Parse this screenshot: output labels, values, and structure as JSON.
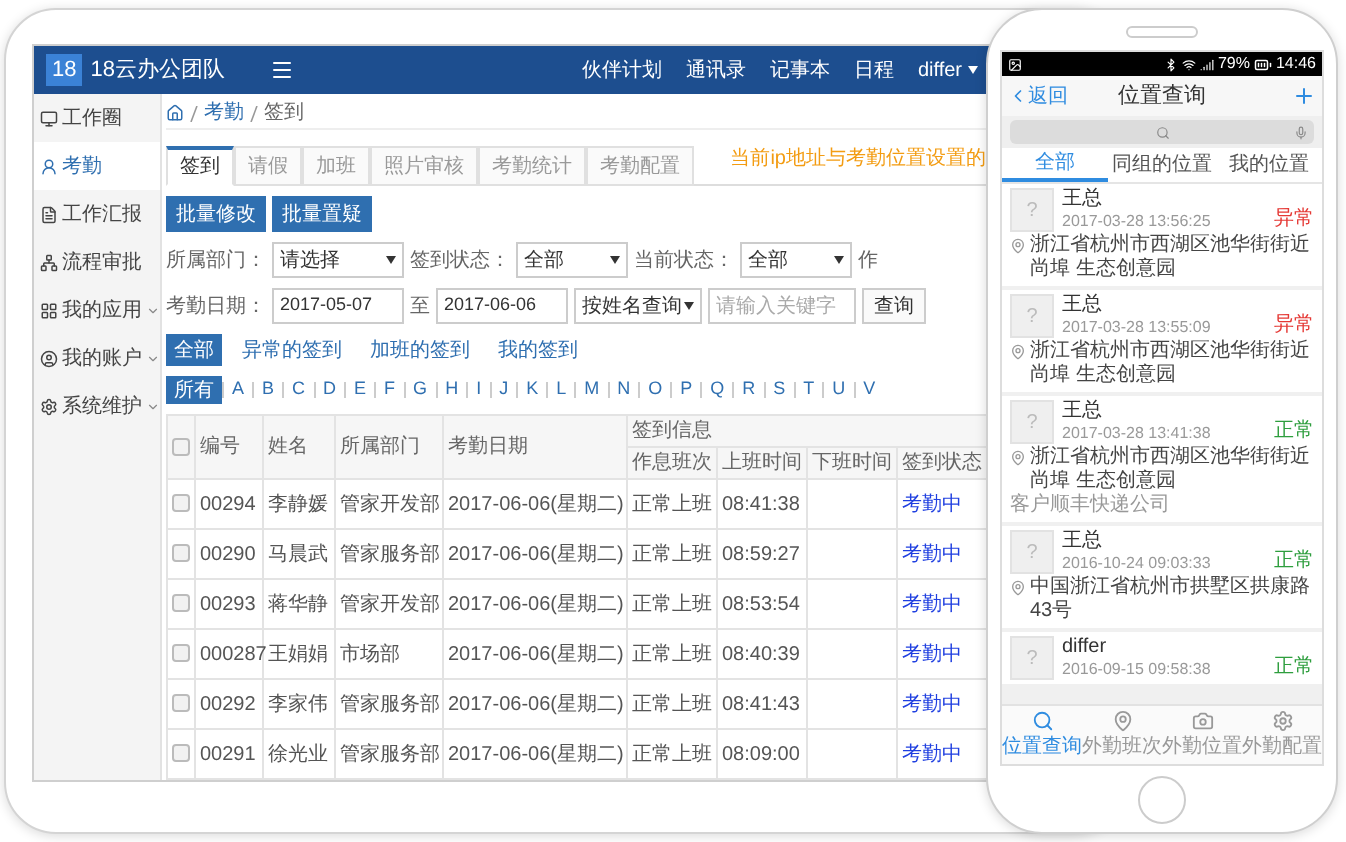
{
  "tablet": {
    "topbar": {
      "logo_badge": "18",
      "brand": "18云办公团队",
      "links": [
        "伙伴计划",
        "通讯录",
        "记事本",
        "日程"
      ],
      "user": "differ"
    },
    "sidebar": [
      {
        "label": "工作圈",
        "selected": false,
        "expandable": false
      },
      {
        "label": "考勤",
        "selected": true,
        "expandable": false
      },
      {
        "label": "工作汇报",
        "selected": false,
        "expandable": false
      },
      {
        "label": "流程审批",
        "selected": false,
        "expandable": false
      },
      {
        "label": "我的应用",
        "selected": false,
        "expandable": true
      },
      {
        "label": "我的账户",
        "selected": false,
        "expandable": true
      },
      {
        "label": "系统维护",
        "selected": false,
        "expandable": true
      }
    ],
    "breadcrumb": [
      "考勤",
      "签到"
    ],
    "tabs": [
      {
        "label": "签到",
        "selected": true
      },
      {
        "label": "请假",
        "selected": false
      },
      {
        "label": "加班",
        "selected": false
      },
      {
        "label": "照片审核",
        "selected": false
      },
      {
        "label": "考勤统计",
        "selected": false
      },
      {
        "label": "考勤配置",
        "selected": false
      }
    ],
    "notice": "当前ip地址与考勤位置设置的",
    "actions": [
      "批量修改",
      "批量置疑"
    ],
    "filters": [
      {
        "label": "所属部门：",
        "value": "请选择"
      },
      {
        "label": "签到状态：",
        "value": "全部"
      },
      {
        "label": "当前状态：",
        "value": "全部"
      }
    ],
    "filter_cut_label": "作",
    "date_label": "考勤日期：",
    "date_from": "2017-05-07",
    "date_sep": "至",
    "date_to": "2017-06-06",
    "search_by": "按姓名查询",
    "keyword_placeholder": "请输入关键字",
    "search_button": "查询",
    "scopes": [
      {
        "label": "全部",
        "selected": true
      },
      {
        "label": "异常的签到",
        "selected": false
      },
      {
        "label": "加班的签到",
        "selected": false
      },
      {
        "label": "我的签到",
        "selected": false
      }
    ],
    "letters": [
      {
        "label": "所有",
        "selected": true
      },
      {
        "label": "A",
        "selected": false
      },
      {
        "label": "B",
        "selected": false
      },
      {
        "label": "C",
        "selected": false
      },
      {
        "label": "D",
        "selected": false
      },
      {
        "label": "E",
        "selected": false
      },
      {
        "label": "F",
        "selected": false
      },
      {
        "label": "G",
        "selected": false
      },
      {
        "label": "H",
        "selected": false
      },
      {
        "label": "I",
        "selected": false
      },
      {
        "label": "J",
        "selected": false
      },
      {
        "label": "K",
        "selected": false
      },
      {
        "label": "L",
        "selected": false
      },
      {
        "label": "M",
        "selected": false
      },
      {
        "label": "N",
        "selected": false
      },
      {
        "label": "O",
        "selected": false
      },
      {
        "label": "P",
        "selected": false
      },
      {
        "label": "Q",
        "selected": false
      },
      {
        "label": "R",
        "selected": false
      },
      {
        "label": "S",
        "selected": false
      },
      {
        "label": "T",
        "selected": false
      },
      {
        "label": "U",
        "selected": false
      },
      {
        "label": "V",
        "selected": false
      }
    ],
    "table": {
      "all_checked": false,
      "columns": [
        "编号",
        "姓名",
        "所属部门",
        "考勤日期"
      ],
      "group_header": "签到信息",
      "sub_columns": [
        "作息班次",
        "上班时间",
        "下班时间",
        "签到状态"
      ],
      "rows": [
        {
          "checked": false,
          "id": "00294",
          "name": "李静媛",
          "dept": "管家开发部",
          "date": "2017-06-06(星期二)",
          "shift": "正常上班",
          "clock_in": "08:41:38",
          "status": "考勤中"
        },
        {
          "checked": false,
          "id": "00290",
          "name": "马晨武",
          "dept": "管家服务部",
          "date": "2017-06-06(星期二)",
          "shift": "正常上班",
          "clock_in": "08:59:27",
          "status": "考勤中"
        },
        {
          "checked": false,
          "id": "00293",
          "name": "蒋华静",
          "dept": "管家开发部",
          "date": "2017-06-06(星期二)",
          "shift": "正常上班",
          "clock_in": "08:53:54",
          "status": "考勤中"
        },
        {
          "checked": false,
          "id": "000287",
          "name": "王娟娟",
          "dept": "市场部",
          "date": "2017-06-06(星期二)",
          "shift": "正常上班",
          "clock_in": "08:40:39",
          "status": "考勤中"
        },
        {
          "checked": false,
          "id": "00292",
          "name": "李家伟",
          "dept": "管家服务部",
          "date": "2017-06-06(星期二)",
          "shift": "正常上班",
          "clock_in": "08:41:43",
          "status": "考勤中"
        },
        {
          "checked": false,
          "id": "00291",
          "name": "徐光业",
          "dept": "管家服务部",
          "date": "2017-06-06(星期二)",
          "shift": "正常上班",
          "clock_in": "08:09:00",
          "status": "考勤中"
        }
      ]
    }
  },
  "phone": {
    "status_bar": {
      "battery": "79%",
      "time": "14:46"
    },
    "nav": {
      "back": "返回",
      "title": "位置查询"
    },
    "tabs": [
      {
        "label": "全部",
        "selected": true
      },
      {
        "label": "同组的位置",
        "selected": false
      },
      {
        "label": "我的位置",
        "selected": false
      }
    ],
    "items": [
      {
        "avatar": "?",
        "name": "王总",
        "time": "2017-03-28 13:56:25",
        "tag": "异常",
        "color": "#e53935",
        "address": "浙江省杭州市西湖区池华街街近尚埠 生态创意园"
      },
      {
        "avatar": "?",
        "name": "王总",
        "time": "2017-03-28 13:55:09",
        "tag": "异常",
        "color": "#e53935",
        "address": "浙江省杭州市西湖区池华街街近尚埠 生态创意园"
      },
      {
        "avatar": "?",
        "name": "王总",
        "time": "2017-03-28 13:41:38",
        "tag": "正常",
        "color": "#2e9e3e",
        "address": "浙江省杭州市西湖区池华街街近尚埠 生态创意园",
        "note": "客户顺丰快递公司"
      },
      {
        "avatar": "?",
        "name": "王总",
        "time": "2016-10-24 09:03:33",
        "tag": "正常",
        "color": "#2e9e3e",
        "address": "中国浙江省杭州市拱墅区拱康路43号"
      },
      {
        "avatar": "?",
        "name": "differ",
        "time": "2016-09-15 09:58:38",
        "tag": "正常",
        "color": "#2e9e3e"
      }
    ],
    "bottom_tabs": [
      {
        "label": "位置查询",
        "selected": true
      },
      {
        "label": "外勤班次",
        "selected": false
      },
      {
        "label": "外勤位置",
        "selected": false
      },
      {
        "label": "外勤配置",
        "selected": false
      }
    ]
  }
}
